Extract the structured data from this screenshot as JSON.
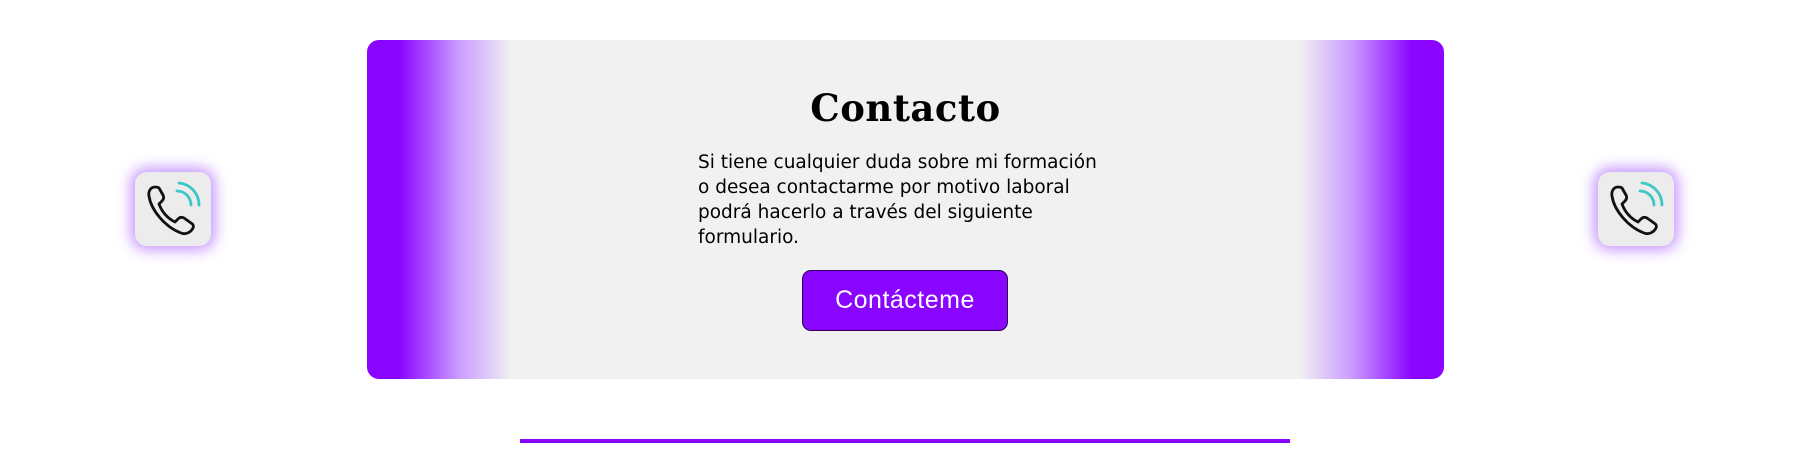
{
  "contact": {
    "title": "Contacto",
    "description": "Si tiene cualquier duda sobre mi formación o desea contactarme por motivo laboral podrá hacerlo a través del siguiente formulario.",
    "button_label": "Contácteme"
  },
  "icons": {
    "left": "phone-call-icon",
    "right": "phone-call-icon"
  },
  "colors": {
    "accent": "#8a05ff",
    "card_background": "#f1f1f1",
    "icon_wave": "#3cc7c7"
  }
}
